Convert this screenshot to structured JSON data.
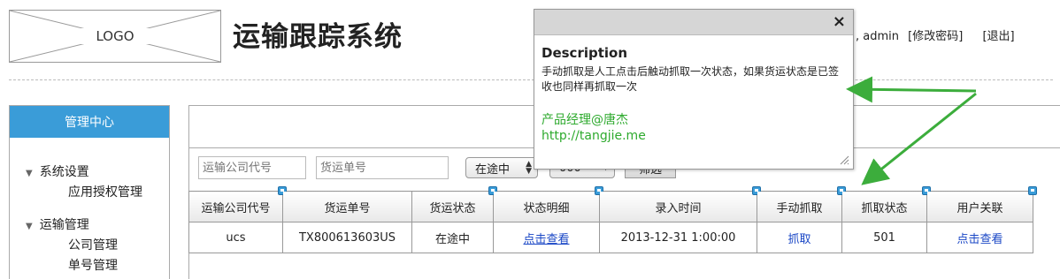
{
  "header": {
    "logo_text": "LOGO",
    "app_title": "运输跟踪系统",
    "user_prefix": ", admin",
    "change_password": "[修改密码]",
    "logout": "[退出]"
  },
  "sidebar": {
    "title": "管理中心",
    "groups": [
      {
        "label": "系统设置",
        "items": [
          "应用授权管理"
        ]
      },
      {
        "label": "运输管理",
        "items": [
          "公司管理",
          "单号管理"
        ]
      }
    ]
  },
  "filters": {
    "company_code_placeholder": "运输公司代号",
    "tracking_no_placeholder": "货运单号",
    "status_select": "在途中",
    "code_select": "000",
    "filter_button": "筛选"
  },
  "table": {
    "columns": [
      "运输公司代号",
      "货运单号",
      "货运状态",
      "状态明细",
      "录入时间",
      "手动抓取",
      "抓取状态",
      "用户关联"
    ],
    "rows": [
      [
        "ucs",
        "TX800613603US",
        "在途中",
        "点击查看",
        "2013-12-31 1:00:00",
        "抓取",
        "501",
        "点击查看"
      ]
    ]
  },
  "popup": {
    "close_symbol": "×",
    "title": "Description",
    "description": "手动抓取是人工点击后触动抓取一次状态，如果货运状态是已签收也同样再抓取一次",
    "author": "产品经理@唐杰",
    "url": "http://tangjie.me"
  },
  "colors": {
    "accent_blue": "#3a9cd8",
    "link_blue": "#1a47c6",
    "annotation_green": "#2eaa2e"
  }
}
